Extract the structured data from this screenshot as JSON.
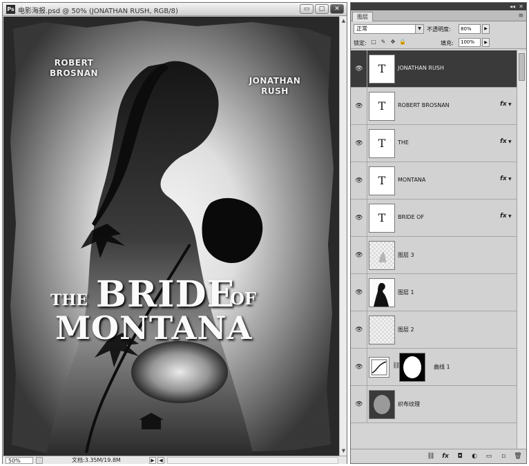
{
  "document": {
    "app_icon": "Ps",
    "title": "电影海报.psd @ 50% (JONATHAN RUSH, RGB/8)",
    "window_buttons": [
      "▭",
      "□",
      "✕"
    ],
    "zoom": "50%",
    "doc_size": "文档:3.35M/19.8M",
    "status_arrow": "▶",
    "status_arrow2": "◀"
  },
  "poster": {
    "actor_left": "ROBERT\nBROSNAN",
    "actor_right": "JONATHAN\nRUSH",
    "title_the": "THE",
    "title_bride": "BRIDE",
    "title_of": "OF",
    "title_montana": "MONTANA"
  },
  "panel": {
    "tab_label": "图层",
    "menu_icon": "≡",
    "blend_mode": "正常",
    "opacity_label": "不透明度:",
    "opacity_value": "80%",
    "lock_label": "锁定:",
    "lock_icons": [
      "□",
      "✎",
      "✥",
      "🔒"
    ],
    "fill_label": "填充:",
    "fill_value": "100%",
    "dropdown_arrow": "▼",
    "spin_arrow": "▶",
    "fx_label": "fx",
    "fx_arrow": "▼",
    "eye_glyph": "👁",
    "chain_glyph": "⛓",
    "layers": [
      {
        "name": "JONATHAN RUSH",
        "thumb": "T",
        "fx": false,
        "selected": true
      },
      {
        "name": "ROBERT BROSNAN",
        "thumb": "T",
        "fx": true,
        "selected": false
      },
      {
        "name": "THE",
        "thumb": "T",
        "fx": true,
        "selected": false
      },
      {
        "name": "MONTANA",
        "thumb": "T",
        "fx": true,
        "selected": false
      },
      {
        "name": "BRIDE OF",
        "thumb": "T",
        "fx": true,
        "selected": false
      },
      {
        "name": "图层 3",
        "thumb": "",
        "fx": false,
        "selected": false
      },
      {
        "name": "图层 1",
        "thumb": "",
        "fx": false,
        "selected": false
      },
      {
        "name": "图层 2",
        "thumb": "",
        "fx": false,
        "selected": false
      },
      {
        "name": "曲线 1",
        "thumb": "",
        "fx": false,
        "selected": false
      },
      {
        "name": "织布纹理",
        "thumb": "",
        "fx": false,
        "selected": false
      }
    ],
    "bottom_icons": [
      "⛓",
      "fx",
      "◘",
      "◐",
      "▭",
      "▫",
      "🗑"
    ]
  },
  "colors": {
    "selected_layer": "#3a3a3a",
    "panel_bg": "#d4d4d4"
  }
}
